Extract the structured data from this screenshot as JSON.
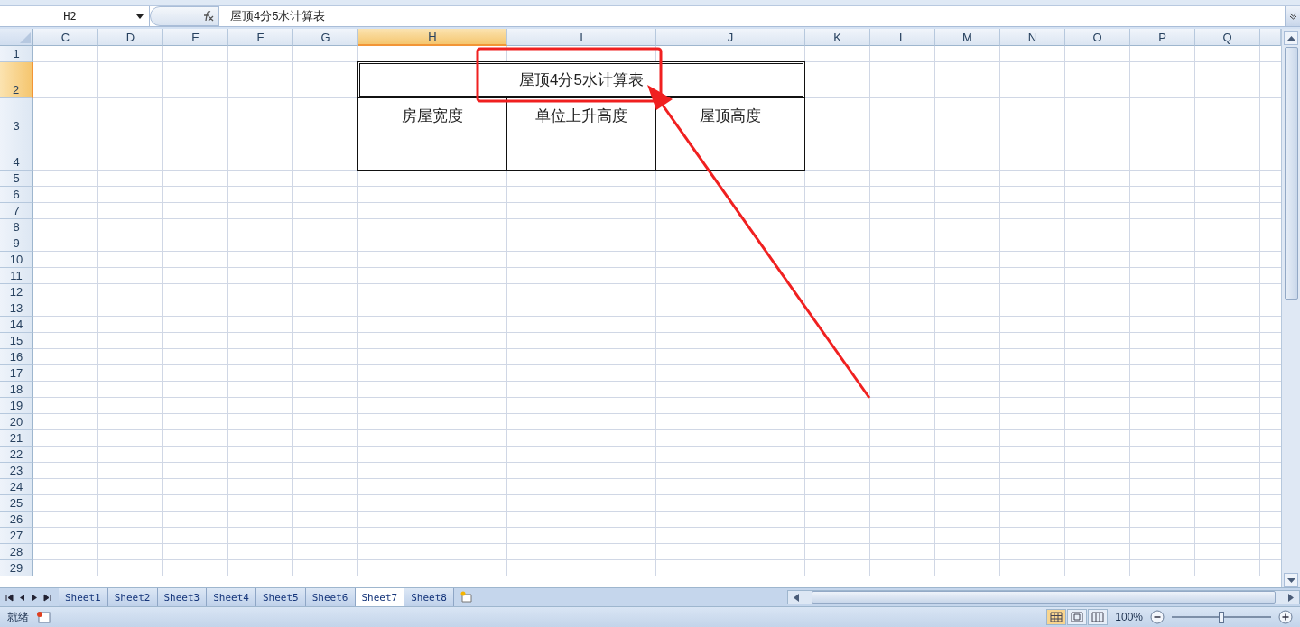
{
  "formula_bar": {
    "name_box": "H2",
    "formula": "屋顶4分5水计算表"
  },
  "columns": [
    {
      "label": "C",
      "selected": false
    },
    {
      "label": "D",
      "selected": false
    },
    {
      "label": "E",
      "selected": false
    },
    {
      "label": "F",
      "selected": false
    },
    {
      "label": "G",
      "selected": false
    },
    {
      "label": "H",
      "selected": true
    },
    {
      "label": "I",
      "selected": false
    },
    {
      "label": "J",
      "selected": false
    },
    {
      "label": "K",
      "selected": false
    },
    {
      "label": "L",
      "selected": false
    },
    {
      "label": "M",
      "selected": false
    },
    {
      "label": "N",
      "selected": false
    },
    {
      "label": "O",
      "selected": false
    },
    {
      "label": "P",
      "selected": false
    },
    {
      "label": "Q",
      "selected": false
    }
  ],
  "rows": [
    {
      "label": "1",
      "selected": false
    },
    {
      "label": "2",
      "selected": true
    },
    {
      "label": "3",
      "selected": false
    },
    {
      "label": "4",
      "selected": false
    },
    {
      "label": "5",
      "selected": false
    },
    {
      "label": "6",
      "selected": false
    },
    {
      "label": "7",
      "selected": false
    },
    {
      "label": "8",
      "selected": false
    },
    {
      "label": "9",
      "selected": false
    },
    {
      "label": "10",
      "selected": false
    },
    {
      "label": "11",
      "selected": false
    },
    {
      "label": "12",
      "selected": false
    },
    {
      "label": "13",
      "selected": false
    },
    {
      "label": "14",
      "selected": false
    },
    {
      "label": "15",
      "selected": false
    },
    {
      "label": "16",
      "selected": false
    },
    {
      "label": "17",
      "selected": false
    },
    {
      "label": "18",
      "selected": false
    },
    {
      "label": "19",
      "selected": false
    },
    {
      "label": "20",
      "selected": false
    },
    {
      "label": "21",
      "selected": false
    },
    {
      "label": "22",
      "selected": false
    },
    {
      "label": "23",
      "selected": false
    },
    {
      "label": "24",
      "selected": false
    },
    {
      "label": "25",
      "selected": false
    },
    {
      "label": "26",
      "selected": false
    },
    {
      "label": "27",
      "selected": false
    },
    {
      "label": "28",
      "selected": false
    },
    {
      "label": "29",
      "selected": false
    }
  ],
  "table": {
    "title": "屋顶4分5水计算表",
    "title_active": true,
    "headers": [
      "房屋宽度",
      "单位上升高度",
      "屋顶高度"
    ]
  },
  "sheets": [
    {
      "label": "Sheet1",
      "selected": false
    },
    {
      "label": "Sheet2",
      "selected": false
    },
    {
      "label": "Sheet3",
      "selected": false
    },
    {
      "label": "Sheet4",
      "selected": false
    },
    {
      "label": "Sheet5",
      "selected": false
    },
    {
      "label": "Sheet6",
      "selected": false
    },
    {
      "label": "Sheet7",
      "selected": true
    },
    {
      "label": "Sheet8",
      "selected": false
    }
  ],
  "status_bar": {
    "status": "就绪",
    "zoom": "100%",
    "zoom_slider": {
      "level": 0.5
    }
  }
}
